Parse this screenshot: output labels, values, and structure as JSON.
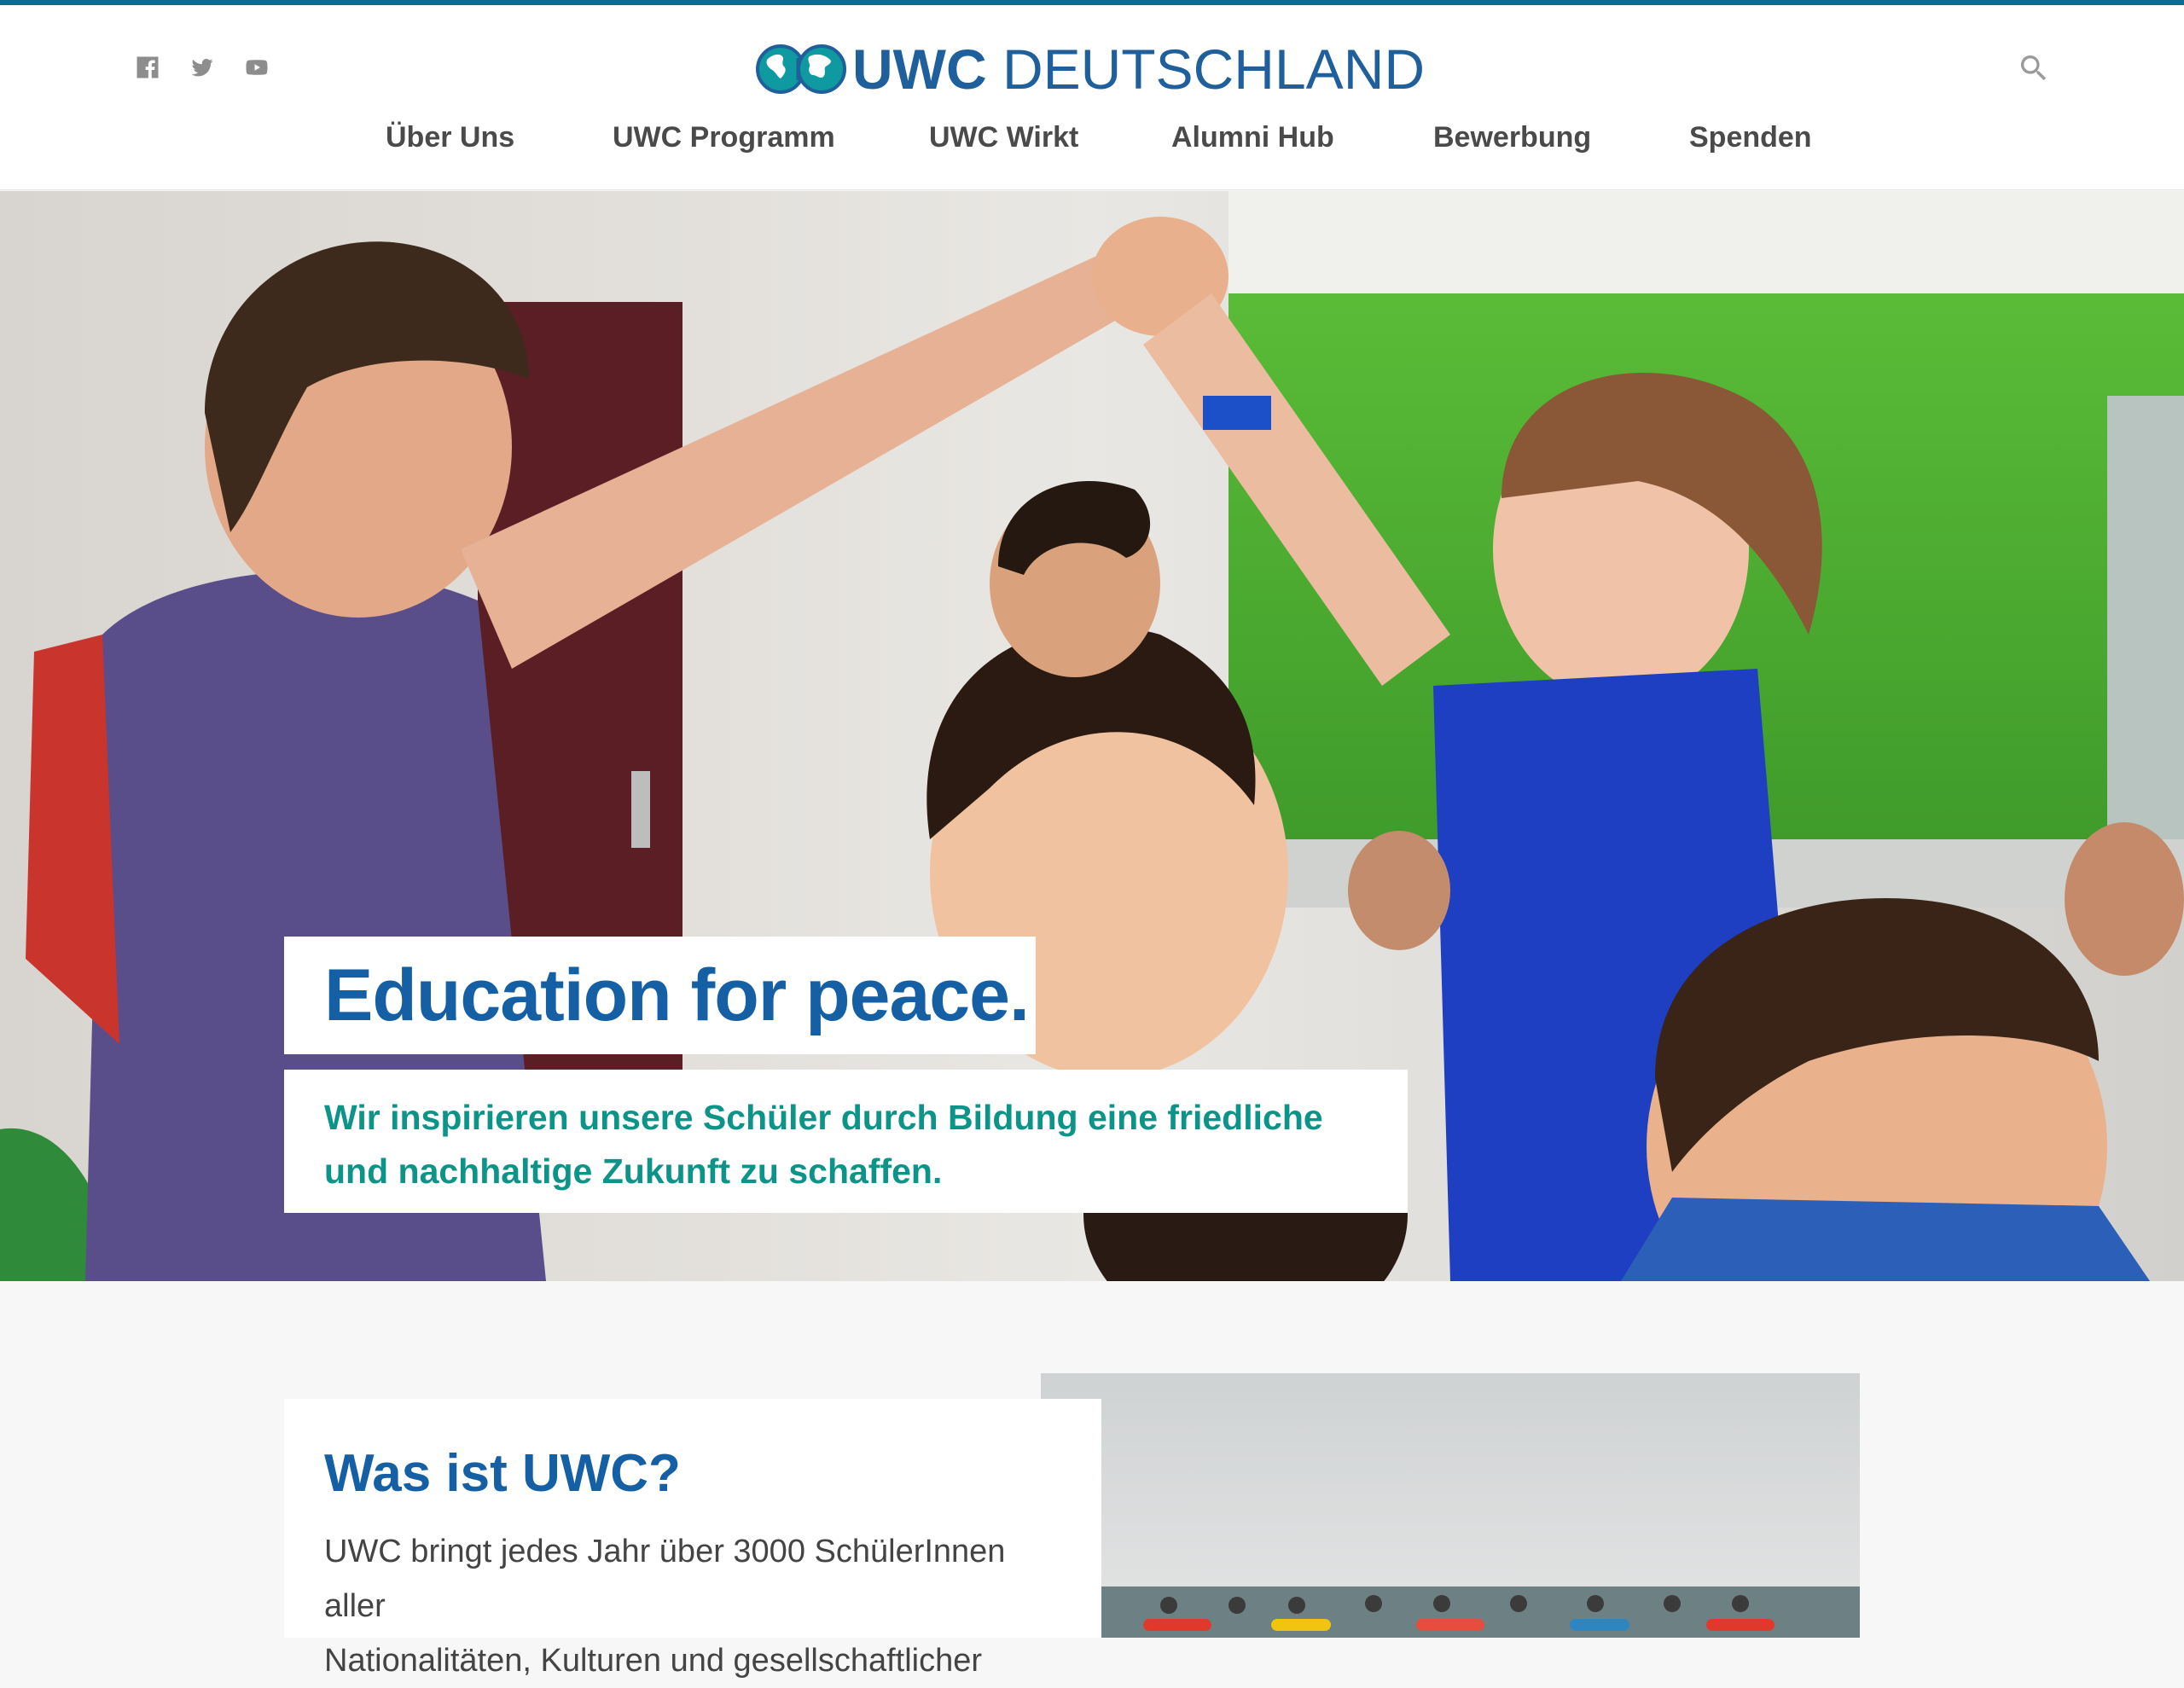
{
  "header": {
    "logo_text_uwc": "UWC",
    "logo_text_rest": " DEUTSCHLAND",
    "social": [
      {
        "icon": "facebook-icon"
      },
      {
        "icon": "twitter-icon"
      },
      {
        "icon": "youtube-icon"
      }
    ],
    "search_icon": "search-icon"
  },
  "nav": {
    "items": [
      {
        "label": "Über Uns"
      },
      {
        "label": "UWC Programm"
      },
      {
        "label": "UWC Wirkt"
      },
      {
        "label": "Alumni Hub"
      },
      {
        "label": "Bewerbung"
      },
      {
        "label": "Spenden"
      }
    ]
  },
  "hero": {
    "title": "Education for peace.",
    "subtitle_line1": "Wir inspirieren unsere Schüler durch Bildung eine friedliche",
    "subtitle_line2": "und nachhaltige Zukunft zu schaffen."
  },
  "section": {
    "heading": "Was ist UWC?",
    "text_line1": "UWC bringt jedes Jahr über 3000 SchülerInnen aller",
    "text_line2": "Nationalitäten, Kulturen und gesellschaftlicher"
  },
  "colors": {
    "brand_blue": "#1560a4",
    "teal": "#0d9488",
    "top_bar": "#0a6e8d"
  }
}
